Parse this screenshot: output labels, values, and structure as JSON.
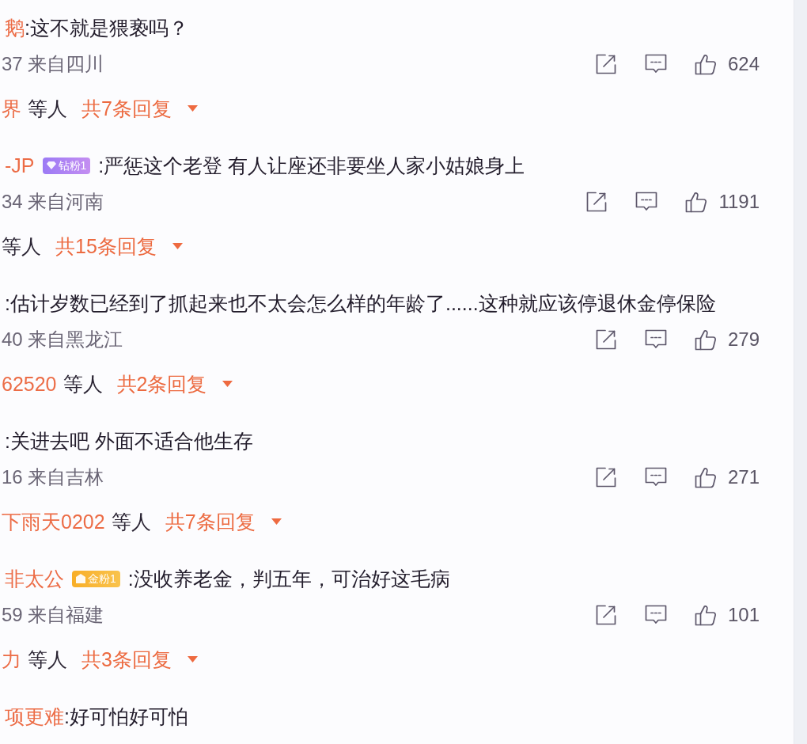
{
  "comments": [
    {
      "user": "鹅",
      "text": ":这不就是猥亵吗？",
      "meta": "37 来自四川",
      "likes": "624",
      "replies": {
        "from": "界",
        "others": "等人",
        "count": "共7条回复",
        "expanded": false
      }
    },
    {
      "user": "-JP",
      "badge": {
        "kind": "diamond",
        "label": "钻粉1"
      },
      "text": ":严惩这个老登 有人让座还非要坐人家小姑娘身上",
      "meta": "34 来自河南",
      "likes": "1191",
      "replies": {
        "others": "等人",
        "count": "共15条回复",
        "expanded": false
      }
    },
    {
      "text": ":估计岁数已经到了抓起来也不太会怎么样的年龄了......这种就应该停退休金停保险",
      "meta": "40 来自黑龙江",
      "likes": "279",
      "replies": {
        "from": "62520",
        "others": "等人",
        "count": "共2条回复",
        "expanded": false
      }
    },
    {
      "text": ":关进去吧 外面不适合他生存",
      "meta": "16 来自吉林",
      "likes": "271",
      "replies": {
        "from": "下雨天0202",
        "others": "等人",
        "count": "共7条回复",
        "expanded": false
      }
    },
    {
      "user": "非太公",
      "badge": {
        "kind": "gold",
        "label": "金粉1"
      },
      "text": ":没收养老金，判五年，可治好这毛病",
      "meta": "59 来自福建",
      "likes": "101",
      "replies": {
        "from": "力",
        "others": "等人",
        "count": "共3条回复",
        "expanded": false
      }
    },
    {
      "user": "项更难",
      "text": ":好可怕好可怕"
    }
  ]
}
